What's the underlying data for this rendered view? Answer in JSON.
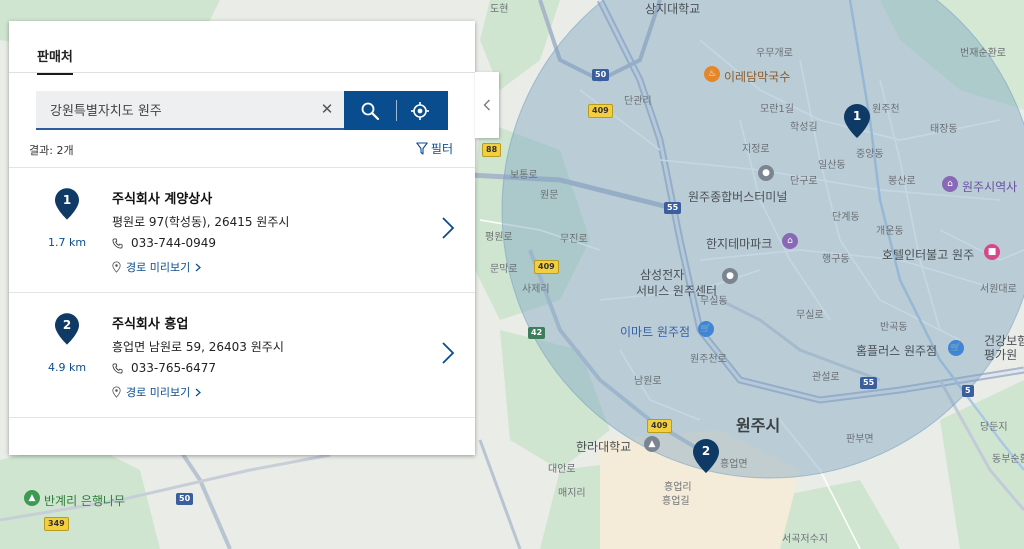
{
  "panel": {
    "tab_label": "판매처",
    "search": {
      "value": "강원특별자치도 원주",
      "placeholder": ""
    },
    "results_count": "결과: 2개",
    "filter_label": "필터",
    "items": [
      {
        "num": "1",
        "name": "주식회사 계양상사",
        "address": "평원로 97(학성동), 26415 원주시",
        "phone": "033-744-0949",
        "distance": "1.7 km",
        "route_label": "경로 미리보기"
      },
      {
        "num": "2",
        "name": "주식회사 흥업",
        "address": "흥업면 남원로 59, 26403 원주시",
        "phone": "033-765-6477",
        "distance": "4.9 km",
        "route_label": "경로 미리보기"
      }
    ]
  },
  "map": {
    "city_label": "원주시",
    "pins": [
      {
        "num": "1"
      },
      {
        "num": "2"
      }
    ],
    "pois": [
      {
        "label": "상지대학교"
      },
      {
        "label": "이레담막국수"
      },
      {
        "label": "원주종합버스터미널"
      },
      {
        "label": "한지테마파크"
      },
      {
        "label": "삼성전자"
      },
      {
        "label": "서비스 원주센터"
      },
      {
        "label": "이마트 원주점"
      },
      {
        "label": "원주시역사"
      },
      {
        "label": "호텔인터불고 원주"
      },
      {
        "label": "홈플러스 원주점"
      },
      {
        "label": "건강보험"
      },
      {
        "label": "평가원"
      },
      {
        "label": "한라대학교"
      },
      {
        "label": "반계리 은행나무"
      }
    ],
    "area_labels": [
      "우무개로",
      "번재순환로",
      "단관리",
      "모란1길",
      "학성길",
      "중앙동",
      "일산동",
      "원주천",
      "지정로",
      "단구로",
      "봉산로",
      "보통로",
      "원문",
      "평원로",
      "무실동",
      "행구동",
      "개운동",
      "반곡동",
      "태장동",
      "단계동",
      "사제리",
      "판부면",
      "남원로",
      "흥업리",
      "흥업길",
      "서곡저수지",
      "당둔지",
      "서원대로",
      "대안로",
      "매지리",
      "원주천로",
      "무실로",
      "관설로",
      "동부순환로",
      "흥업면",
      "문막로",
      "무진로",
      "도현"
    ],
    "shields": [
      "50",
      "409",
      "88",
      "55",
      "409",
      "42",
      "55",
      "5",
      "409",
      "50",
      "349"
    ],
    "colors": {
      "radius_fill": "#7aa3c2",
      "primary": "#0a4d8f",
      "pin": "#0f3a66"
    }
  }
}
